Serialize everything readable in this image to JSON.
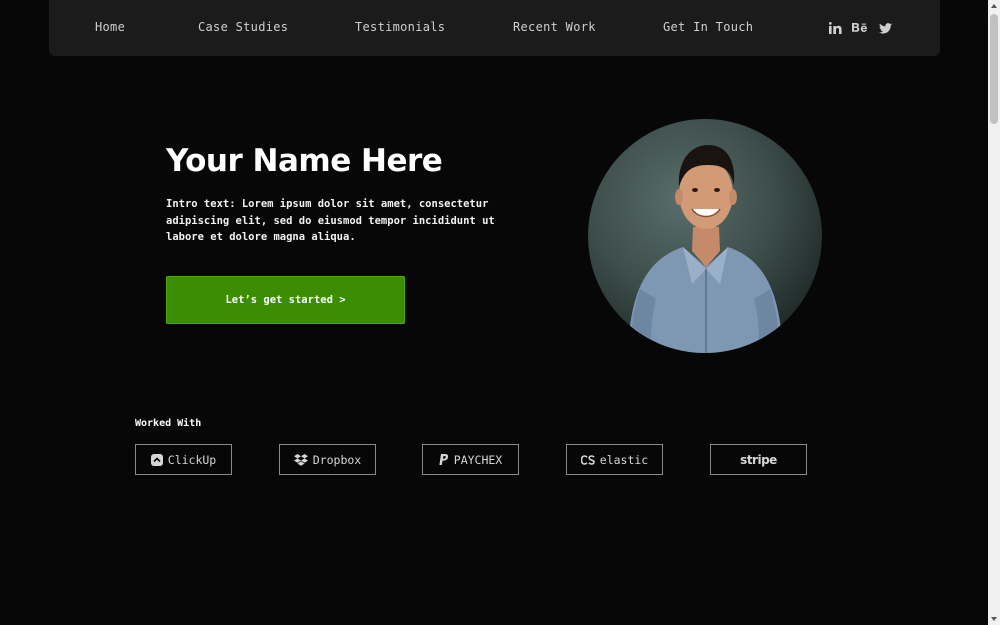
{
  "nav": {
    "links": [
      "Home",
      "Case Studies",
      "Testimonials",
      "Recent Work",
      "Get In Touch"
    ],
    "social": [
      "linkedin-icon",
      "behance-icon",
      "twitter-icon"
    ]
  },
  "hero": {
    "title": "Your Name Here",
    "intro": "Intro text: Lorem ipsum dolor sit amet, consectetur adipiscing elit, sed do eiusmod tempor incididunt ut labore et dolore magna aliqua.",
    "cta_label": "Let’s get started >",
    "cta_color": "#3b8d02"
  },
  "worked_with": {
    "label": "Worked With",
    "logos": [
      "ClickUp",
      "Dropbox",
      "PAYCHEX",
      "elastic",
      "stripe"
    ]
  },
  "colors": {
    "background": "#070707",
    "navbar": "#1b1b1b",
    "accent": "#3b8d02"
  }
}
